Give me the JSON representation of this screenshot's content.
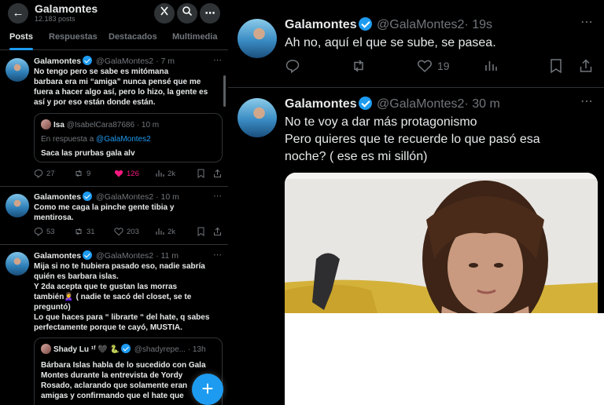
{
  "left": {
    "header": {
      "name": "Galamontes",
      "posts_count": "12.183 posts"
    },
    "tabs": [
      "Posts",
      "Respuestas",
      "Destacados",
      "Multimedia"
    ],
    "tweets": [
      {
        "name": "Galamontes",
        "handle": "@GalaMontes2",
        "time": "· 7 m",
        "text_lines": [
          "No tengo  pero se sabe es mitómana",
          "barbara era mi “amiga” nunca pensé que me",
          "fuera a hacer algo así, pero lo hizo, la gente es",
          "así y por  eso están donde están."
        ],
        "quote": {
          "name": "Isa",
          "handle": "@IsabelCara87686",
          "time": "· 10 m",
          "reply_prefix": "En respuesta a",
          "reply_to": "@GalaMontes2",
          "text": "Saca las prurbas gala alv"
        },
        "replies": "27",
        "reposts": "9",
        "likes": "126",
        "views": "2k"
      },
      {
        "name": "Galamontes",
        "handle": "@GalaMontes2",
        "time": "· 10 m",
        "text_lines": [
          "Como me caga la pinche gente tibia y",
          "mentirosa."
        ],
        "replies": "53",
        "reposts": "31",
        "likes": "203",
        "views": "2k"
      },
      {
        "name": "Galamontes",
        "handle": "@GalaMontes2",
        "time": "· 11 m",
        "text_lines": [
          "Mija si no te hubiera pasado eso, nadie sabría",
          "quién es barbara islas.",
          "Y 2da  acepta  que te gustan las morras",
          "también🙎‍♀️ ( nadie te sacó del closet, se te",
          "preguntó)",
          "Lo que haces para “ librarte “ del hate, q sabes",
          "perfectamente  porque te cayó, MUSTIA."
        ],
        "quote": {
          "name": "Shady Lu ¹ᶠ 🖤 🐍",
          "handle": "@shadyrepe...",
          "time": "· 13h",
          "text_lines": [
            "Bárbara Islas habla de lo sucedido con Gala",
            "Montes durante la entrevista de Yordy",
            "Rosado, aclarando que solamente eran",
            "amigas y confirmando que el hate que"
          ]
        }
      }
    ]
  },
  "right": {
    "tweets": [
      {
        "name": "Galamontes",
        "handle": "@GalaMontes2",
        "time": "· 19s",
        "text": "Ah no, aquí el que se sube, se pasea.",
        "likes": "19"
      },
      {
        "name": "Galamontes",
        "handle": "@GalaMontes2",
        "time": "· 30 m",
        "text_lines": [
          "No te voy a dar más protagonismo",
          "Pero quieres que te recuerde lo que pasó esa",
          "noche? ( ese es mi sillón)"
        ]
      }
    ]
  },
  "colors": {
    "accent": "#1d9bf0",
    "like_active": "#f91880",
    "text": "#e7e9ea",
    "muted": "#71767b"
  }
}
